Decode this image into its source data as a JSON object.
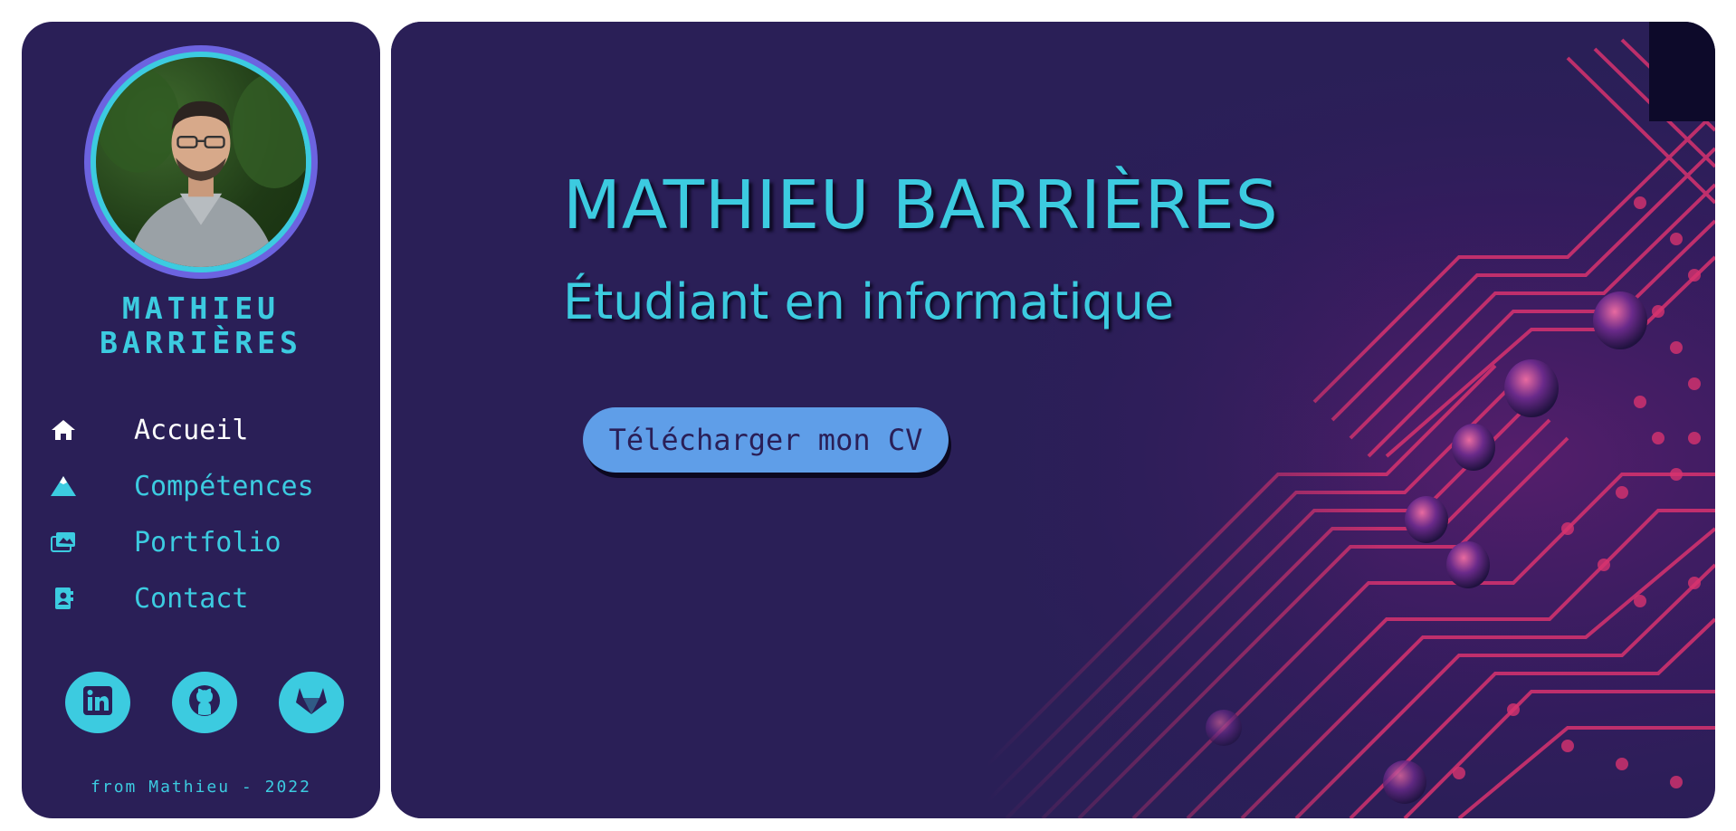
{
  "profile": {
    "name_line1": "MATHIEU",
    "name_line2": "BARRIÈRES",
    "avatar": "profile-photo"
  },
  "nav": {
    "items": [
      {
        "label": "Accueil",
        "icon": "home-icon",
        "active": true
      },
      {
        "label": "Compétences",
        "icon": "mountain-icon",
        "active": false
      },
      {
        "label": "Portfolio",
        "icon": "images-icon",
        "active": false
      },
      {
        "label": "Contact",
        "icon": "address-book-icon",
        "active": false
      }
    ]
  },
  "socials": [
    {
      "icon": "linkedin-icon"
    },
    {
      "icon": "github-icon"
    },
    {
      "icon": "gitlab-icon"
    }
  ],
  "footer": "from Mathieu - 2022",
  "hero": {
    "title": "MATHIEU BARRIÈRES",
    "subtitle": "Étudiant en informatique",
    "cv_button": "Télécharger mon CV"
  },
  "colors": {
    "background": "#2a1f57",
    "accent": "#3ccbe0",
    "button": "#5f9ee8",
    "circuit": "#e0356e"
  }
}
